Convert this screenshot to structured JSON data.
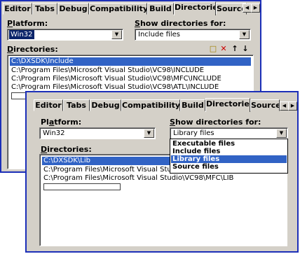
{
  "back_dialog": {
    "tabs": [
      "Editor",
      "Tabs",
      "Debug",
      "Compatibility",
      "Build",
      "Directories",
      "Source"
    ],
    "selected_tab": "Directories",
    "platform_label_pre": "",
    "platform_label_ul": "P",
    "platform_label_post": "latform:",
    "platform_value": "Win32",
    "show_dirs_label_pre": "",
    "show_dirs_label_ul": "S",
    "show_dirs_label_post": "how directories for:",
    "show_dirs_value": "Include files",
    "directories_label_pre": "",
    "directories_label_ul": "D",
    "directories_label_post": "irectories:",
    "directories": [
      "C:\\DXSDK\\Include",
      "C:\\Program Files\\Microsoft Visual Studio\\VC98\\INCLUDE",
      "C:\\Program Files\\Microsoft Visual Studio\\VC98\\MFC\\INCLUDE",
      "C:\\Program Files\\Microsoft Visual Studio\\VC98\\ATL\\INCLUDE"
    ],
    "selected_directory_index": 0
  },
  "front_dialog": {
    "tabs": [
      "Editor",
      "Tabs",
      "Debug",
      "Compatibility",
      "Build",
      "Directories",
      "Source"
    ],
    "selected_tab": "Directories",
    "platform_label_pre": "Pl",
    "platform_label_ul": "a",
    "platform_label_post": "tform:",
    "platform_value": "Win32",
    "show_dirs_label_pre": "",
    "show_dirs_label_ul": "S",
    "show_dirs_label_post": "how directories for:",
    "show_dirs_value": "Library files",
    "directories_label_pre": "",
    "directories_label_ul": "D",
    "directories_label_post": "irectories:",
    "directories": [
      "C:\\DXSDK\\Lib",
      "C:\\Program Files\\Microsoft Visual Studio\\VC98\\LIB",
      "C:\\Program Files\\Microsoft Visual Studio\\VC98\\MFC\\LIB"
    ],
    "selected_directory_index": 0,
    "dropdown_options": [
      "Executable files",
      "Include files",
      "Library files",
      "Source files"
    ],
    "dropdown_highlight_index": 2
  },
  "icons": {
    "scroll_left": "◀",
    "scroll_right": "▶",
    "dropdown_arrow": "▼",
    "new_folder": "□",
    "delete": "✕",
    "move_up": "↑",
    "move_down": "↓"
  },
  "colors": {
    "dialog_face": "#d4d0c8",
    "frame_border": "#1c2fb8",
    "selection": "#3163c5",
    "delete_icon": "#cc0000"
  }
}
